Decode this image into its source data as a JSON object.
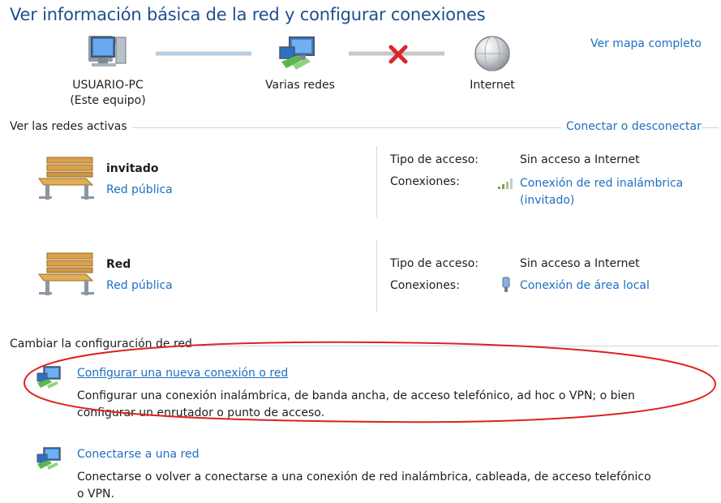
{
  "header": {
    "title": "Ver información básica de la red y configurar conexiones",
    "full_map_link": "Ver mapa completo"
  },
  "map": {
    "computer": {
      "name": "USUARIO-PC",
      "sub": "(Este equipo)"
    },
    "multi": {
      "label": "Varias redes"
    },
    "internet": {
      "label": "Internet"
    }
  },
  "active": {
    "section_label": "Ver las redes activas",
    "connect_link": "Conectar o desconectar",
    "networks": [
      {
        "name": "invitado",
        "type": "Red pública",
        "access_label": "Tipo de acceso:",
        "access_value": "Sin acceso a Internet",
        "conn_label": "Conexiones:",
        "conn_value_1": "Conexión de red inalámbrica",
        "conn_value_2": "(invitado)"
      },
      {
        "name": "Red",
        "type": "Red pública",
        "access_label": "Tipo de acceso:",
        "access_value": "Sin acceso a Internet",
        "conn_label": "Conexiones:",
        "conn_value_1": "Conexión de área local"
      }
    ]
  },
  "change": {
    "section_label": "Cambiar la configuración de red",
    "items": [
      {
        "title": "Configurar una nueva conexión o red",
        "desc_1": "Configurar una conexión inalámbrica, de banda ancha, de acceso telefónico, ad hoc o VPN; o bien",
        "desc_2": "configurar un enrutador o punto de acceso."
      },
      {
        "title": "Conectarse a una red",
        "desc_1": "Conectarse o volver a conectarse a una conexión de red inalámbrica, cableada, de acceso telefónico",
        "desc_2": "o VPN."
      }
    ]
  },
  "colors": {
    "link": "#1f6fc1",
    "title": "#1e4f8c",
    "highlight_ellipse": "#e02020",
    "error_x": "#d9262c"
  }
}
